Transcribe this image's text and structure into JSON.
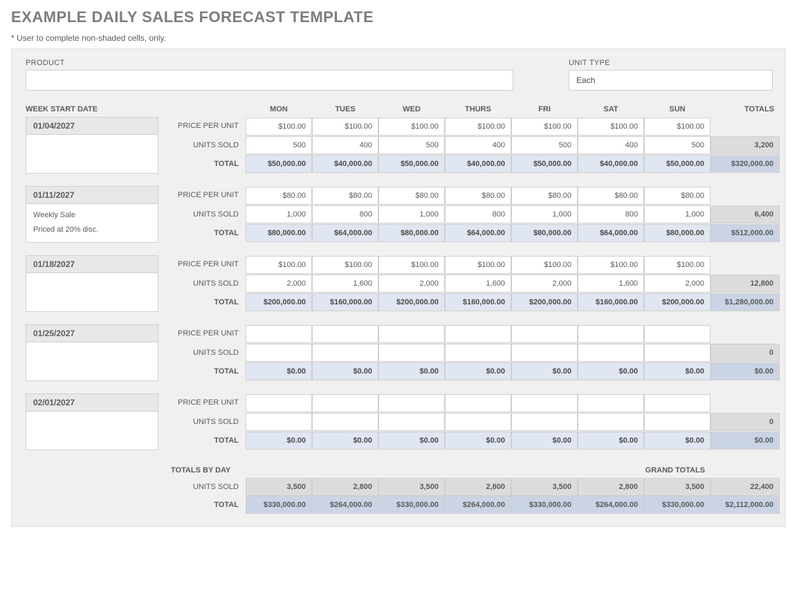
{
  "title": "EXAMPLE DAILY SALES FORECAST TEMPLATE",
  "subtitle": "* User to complete non-shaded cells, only.",
  "labels": {
    "product": "PRODUCT",
    "unit_type": "UNIT TYPE",
    "week_start_date": "WEEK START DATE",
    "price_per_unit": "PRICE PER UNIT",
    "units_sold": "UNITS SOLD",
    "total": "TOTAL",
    "totals_by_day": "TOTALS BY DAY",
    "grand_totals": "GRAND TOTALS",
    "totals_col": "TOTALS"
  },
  "product": "",
  "unit_type": "Each",
  "days": [
    "MON",
    "TUES",
    "WED",
    "THURS",
    "FRI",
    "SAT",
    "SUN"
  ],
  "weeks": [
    {
      "date": "01/04/2027",
      "notes_1": "",
      "notes_2": "",
      "price": [
        "$100.00",
        "$100.00",
        "$100.00",
        "$100.00",
        "$100.00",
        "$100.00",
        "$100.00"
      ],
      "units": [
        "500",
        "400",
        "500",
        "400",
        "500",
        "400",
        "500"
      ],
      "total": [
        "$50,000.00",
        "$40,000.00",
        "$50,000.00",
        "$40,000.00",
        "$50,000.00",
        "$40,000.00",
        "$50,000.00"
      ],
      "units_total": "3,200",
      "week_total": "$320,000.00"
    },
    {
      "date": "01/11/2027",
      "notes_1": "Weekly Sale",
      "notes_2": "Priced at 20% disc.",
      "price": [
        "$80.00",
        "$80.00",
        "$80.00",
        "$80.00",
        "$80.00",
        "$80.00",
        "$80.00"
      ],
      "units": [
        "1,000",
        "800",
        "1,000",
        "800",
        "1,000",
        "800",
        "1,000"
      ],
      "total": [
        "$80,000.00",
        "$64,000.00",
        "$80,000.00",
        "$64,000.00",
        "$80,000.00",
        "$64,000.00",
        "$80,000.00"
      ],
      "units_total": "6,400",
      "week_total": "$512,000.00"
    },
    {
      "date": "01/18/2027",
      "notes_1": "",
      "notes_2": "",
      "price": [
        "$100.00",
        "$100.00",
        "$100.00",
        "$100.00",
        "$100.00",
        "$100.00",
        "$100.00"
      ],
      "units": [
        "2,000",
        "1,600",
        "2,000",
        "1,600",
        "2,000",
        "1,600",
        "2,000"
      ],
      "total": [
        "$200,000.00",
        "$160,000.00",
        "$200,000.00",
        "$160,000.00",
        "$200,000.00",
        "$160,000.00",
        "$200,000.00"
      ],
      "units_total": "12,800",
      "week_total": "$1,280,000.00"
    },
    {
      "date": "01/25/2027",
      "notes_1": "",
      "notes_2": "",
      "price": [
        "",
        "",
        "",
        "",
        "",
        "",
        ""
      ],
      "units": [
        "",
        "",
        "",
        "",
        "",
        "",
        ""
      ],
      "total": [
        "$0.00",
        "$0.00",
        "$0.00",
        "$0.00",
        "$0.00",
        "$0.00",
        "$0.00"
      ],
      "units_total": "0",
      "week_total": "$0.00"
    },
    {
      "date": "02/01/2027",
      "notes_1": "",
      "notes_2": "",
      "price": [
        "",
        "",
        "",
        "",
        "",
        "",
        ""
      ],
      "units": [
        "",
        "",
        "",
        "",
        "",
        "",
        ""
      ],
      "total": [
        "$0.00",
        "$0.00",
        "$0.00",
        "$0.00",
        "$0.00",
        "$0.00",
        "$0.00"
      ],
      "units_total": "0",
      "week_total": "$0.00"
    }
  ],
  "grand": {
    "units_by_day": [
      "3,500",
      "2,800",
      "3,500",
      "2,800",
      "3,500",
      "2,800",
      "3,500"
    ],
    "total_by_day": [
      "$330,000.00",
      "$264,000.00",
      "$330,000.00",
      "$264,000.00",
      "$330,000.00",
      "$264,000.00",
      "$330,000.00"
    ],
    "units_total": "22,400",
    "grand_total": "$2,112,000.00"
  }
}
